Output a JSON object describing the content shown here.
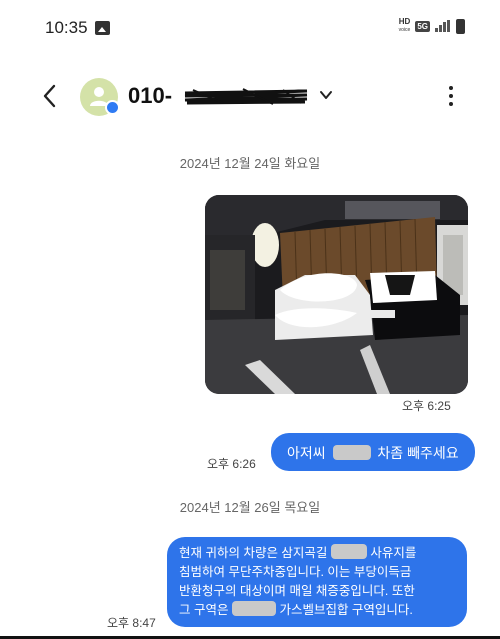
{
  "status_bar": {
    "time": "10:35",
    "hd_label": "HD",
    "voice_label": "voice",
    "network_label": "5G"
  },
  "app_bar": {
    "contact_prefix": "010-",
    "back_icon": "back-arrow-icon",
    "more_icon": "more-vert-icon",
    "avatar_color": "#d4e2a8",
    "badge_color": "#2f7bf3"
  },
  "conversation": {
    "date_1": "2024년 12월 24일 화요일",
    "photo_time": "오후 6:25",
    "message_1": {
      "part_1": "아저씨",
      "part_2": "차좀 빼주세요",
      "time": "오후 6:26"
    },
    "date_2": "2024년 12월 26일 목요일",
    "message_2": {
      "line_1_a": "현재 귀하의 차량은 삼지곡길",
      "line_1_b": "사유지를",
      "line_2": "침범하여 무단주차중입니다.  이는 부당이득금",
      "line_3": "반환청구의 대상이며 매일 채증중입니다. 또한",
      "line_4_a": "그 구역은",
      "line_4_b": "가스벨브집합 구역입니다.",
      "time": "오후 8:47"
    },
    "bubble_color": "#2e74ea"
  }
}
